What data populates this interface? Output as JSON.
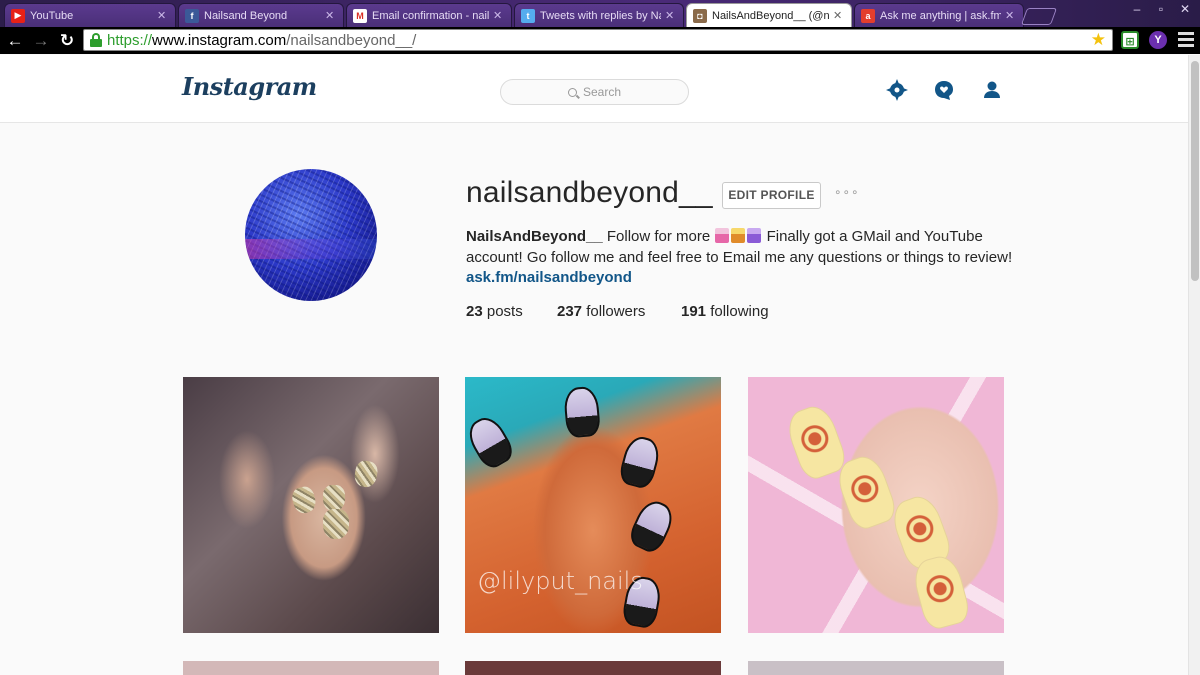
{
  "browser": {
    "tabs": [
      {
        "label": "YouTube",
        "favicon": "youtube-icon",
        "color": "#e62117"
      },
      {
        "label": "Nailsand Beyond",
        "favicon": "facebook-icon",
        "color": "#3b5998"
      },
      {
        "label": "Email confirmation - nail",
        "favicon": "gmail-icon",
        "color": "#d93025"
      },
      {
        "label": "Tweets with replies by Na",
        "favicon": "twitter-icon",
        "color": "#55acee"
      },
      {
        "label": "NailsAndBeyond__ (@nai",
        "favicon": "instagram-icon",
        "color": "#3f729b",
        "active": true
      },
      {
        "label": "Ask me anything | ask.fm",
        "favicon": "askfm-icon",
        "color": "#e33e2d"
      }
    ],
    "url_scheme": "https://",
    "url_host": "www.instagram.com",
    "url_path": "/nailsandbeyond__/",
    "extension_letter": "Y"
  },
  "header": {
    "logo": "Instagram",
    "search_placeholder": "Search"
  },
  "profile": {
    "username": "nailsandbeyond__",
    "edit_button": "EDIT PROFILE",
    "more": "∘∘∘",
    "bio_name": "NailsAndBeyond__",
    "bio_text_1": "Follow for more",
    "bio_text_2": "Finally got a GMail and YouTube account! Go follow me and feel free to Email me any questions or things to review!",
    "bio_link": "ask.fm/nailsandbeyond",
    "stats": {
      "posts_count": "23",
      "posts_label": "posts",
      "followers_count": "237",
      "followers_label": "followers",
      "following_count": "191",
      "following_label": "following"
    }
  },
  "posts": {
    "watermark_2": "@lilyput_nails"
  },
  "colors": {
    "link": "#125688",
    "logo": "#1c3f5f",
    "header_icons": "#125688"
  }
}
